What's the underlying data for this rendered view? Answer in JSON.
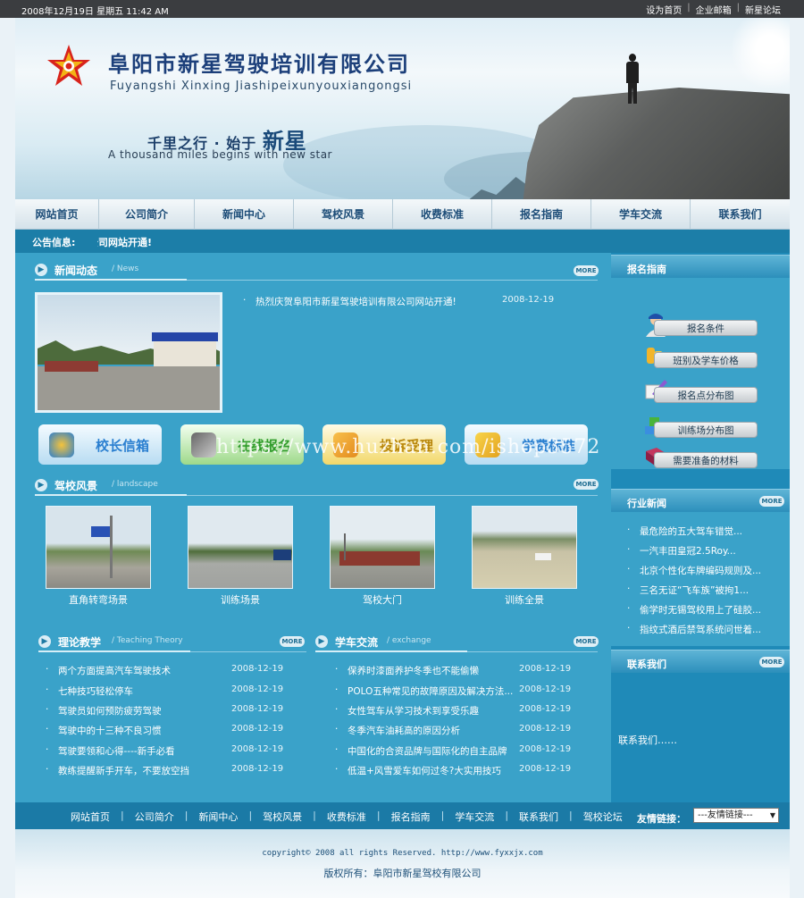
{
  "topbar": {
    "datetime": "2008年12月19日 星期五 11:42 AM",
    "links": [
      "设为首页",
      "企业邮箱",
      "新星论坛"
    ]
  },
  "banner": {
    "company_name": "阜阳市新星驾驶培训有限公司",
    "pinyin": "Fuyangshi Xinxing Jiashipeixunyouxiangongsi",
    "slogan_prefix": "千里之行 · 始于",
    "slogan_bold": "新星",
    "slogan_en": "A thousand miles begins with new star"
  },
  "nav": [
    "网站首页",
    "公司简介",
    "新闻中心",
    "驾校风景",
    "收费标准",
    "报名指南",
    "学车交流",
    "联系我们"
  ],
  "notice": {
    "label": "公告信息:",
    "text": "公司网站开通!"
  },
  "news": {
    "title": "新闻动态",
    "en": "News",
    "more": "MORE",
    "items": [
      {
        "title": "热烈庆贺阜阳市新星驾驶培训有限公司网站开通!",
        "date": "2008-12-19"
      }
    ]
  },
  "big_buttons": [
    {
      "label": "校长信箱",
      "color": "#2a7fd0"
    },
    {
      "label": "在线报名",
      "color": "#2f9b2a"
    },
    {
      "label": "投诉受理",
      "color": "#b8860b"
    },
    {
      "label": "学费标准",
      "color": "#2a7fd0"
    }
  ],
  "watermark": "https://www.huzhan.com/ishop3572",
  "scenery": {
    "title": "驾校风景",
    "en": "landscape",
    "more": "MORE",
    "items": [
      "直角转弯场景",
      "训练场景",
      "驾校大门",
      "训练全景"
    ]
  },
  "theory": {
    "title": "理论教学",
    "en": "Teaching Theory",
    "more": "MORE",
    "items": [
      {
        "title": "两个方面提高汽车驾驶技术",
        "date": "2008-12-19"
      },
      {
        "title": "七种技巧轻松停车",
        "date": "2008-12-19"
      },
      {
        "title": "驾驶员如何预防疲劳驾驶",
        "date": "2008-12-19"
      },
      {
        "title": "驾驶中的十三种不良习惯",
        "date": "2008-12-19"
      },
      {
        "title": "驾驶要领和心得----新手必看",
        "date": "2008-12-19"
      },
      {
        "title": "教练提醒新手开车，不要放空挡",
        "date": "2008-12-19"
      }
    ]
  },
  "exchange": {
    "title": "学车交流",
    "en": "exchange",
    "more": "MORE",
    "items": [
      {
        "title": "保养时漆面养护冬季也不能偷懒",
        "date": "2008-12-19"
      },
      {
        "title": "POLO五种常见的故障原因及解决方法...",
        "date": "2008-12-19"
      },
      {
        "title": "女性驾车从学习技术到享受乐趣",
        "date": "2008-12-19"
      },
      {
        "title": "冬季汽车油耗高的原因分析",
        "date": "2008-12-19"
      },
      {
        "title": "中国化的合资品牌与国际化的自主品牌",
        "date": "2008-12-19"
      },
      {
        "title": "低温+风雪爱车如何过冬?大实用技巧",
        "date": "2008-12-19"
      }
    ]
  },
  "sidebar": {
    "guide_title": "报名指南",
    "guide_items": [
      "报名条件",
      "班别及学车价格",
      "报名点分布图",
      "训练场分布图",
      "需要准备的材料"
    ],
    "industry_title": "行业新闻",
    "industry_more": "MORE",
    "industry_items": [
      "最危险的五大驾车错觉...",
      "一汽丰田皇冠2.5Roy...",
      "北京个性化车牌编码规则及...",
      "三名无证“飞车族”被拘1...",
      "偷学时无锡驾校用上了硅胶...",
      "指纹式酒后禁驾系统问世着..."
    ],
    "contact_title": "联系我们",
    "contact_more": "MORE",
    "contact_text": "联系我们……"
  },
  "footer_nav": {
    "items": [
      "网站首页",
      "公司简介",
      "新闻中心",
      "驾校风景",
      "收费标准",
      "报名指南",
      "学车交流",
      "联系我们",
      "驾校论坛"
    ],
    "friend_label": "友情链接：",
    "friend_select": "---友情链接---"
  },
  "footer": {
    "copyright": "copyright© 2008 all rights Reserved. http://www.fyxxjx.com",
    "owner": "版权所有：阜阳市新星驾校有限公司"
  }
}
